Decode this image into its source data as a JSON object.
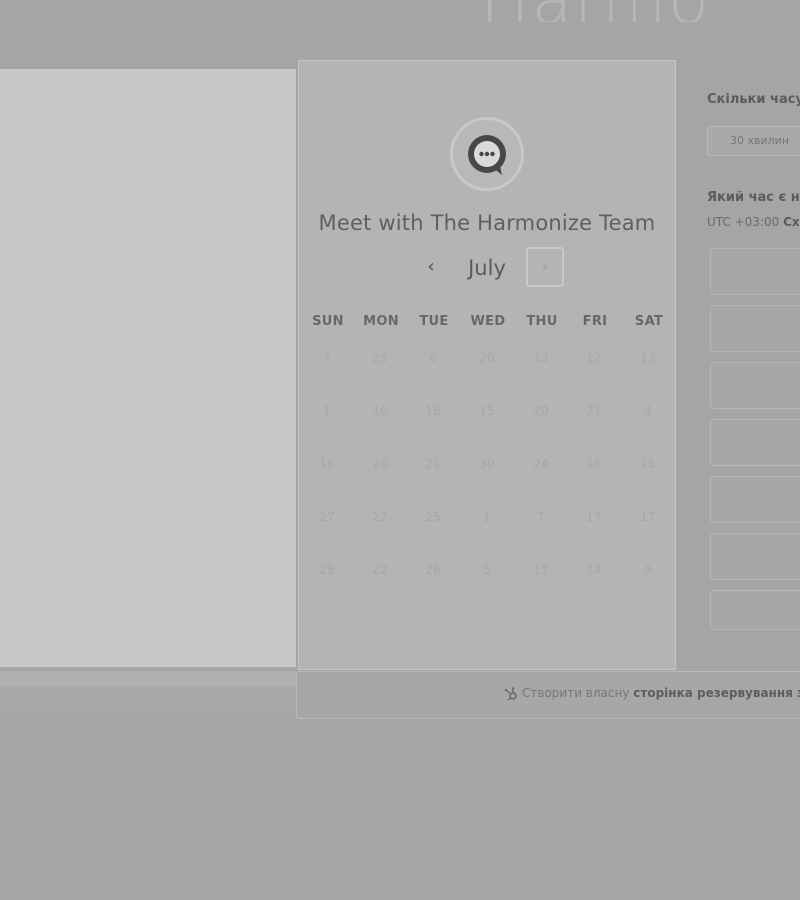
{
  "header": {
    "logo_text": "Harmo"
  },
  "card": {
    "title": "Meet with The Harmonize Team",
    "month": "July",
    "prev_symbol": "‹",
    "next_symbol": "›",
    "weekdays": [
      "SUN",
      "MON",
      "TUE",
      "WED",
      "THU",
      "FRI",
      "SAT"
    ],
    "weeks": [
      [
        "7",
        "25",
        "6",
        "20",
        "13",
        "12",
        "13"
      ],
      [
        "1",
        "16",
        "16",
        "15",
        "20",
        "21",
        "4"
      ],
      [
        "16",
        "26",
        "21",
        "30",
        "24",
        "16",
        "15"
      ],
      [
        "27",
        "22",
        "25",
        "1",
        "7",
        "17",
        "17"
      ],
      [
        "28",
        "22",
        "26",
        "5",
        "17",
        "14",
        "9"
      ]
    ]
  },
  "right_panel": {
    "duration_question": "Скільки часу",
    "duration_value": "30 хвилин",
    "time_question": "Який час є н",
    "timezone_prefix": "UTC +03:00",
    "timezone_name": "Сх",
    "slot_count": 7
  },
  "footer": {
    "text_prefix": "Створити власну",
    "text_bold": "сторінка резервування зу"
  }
}
